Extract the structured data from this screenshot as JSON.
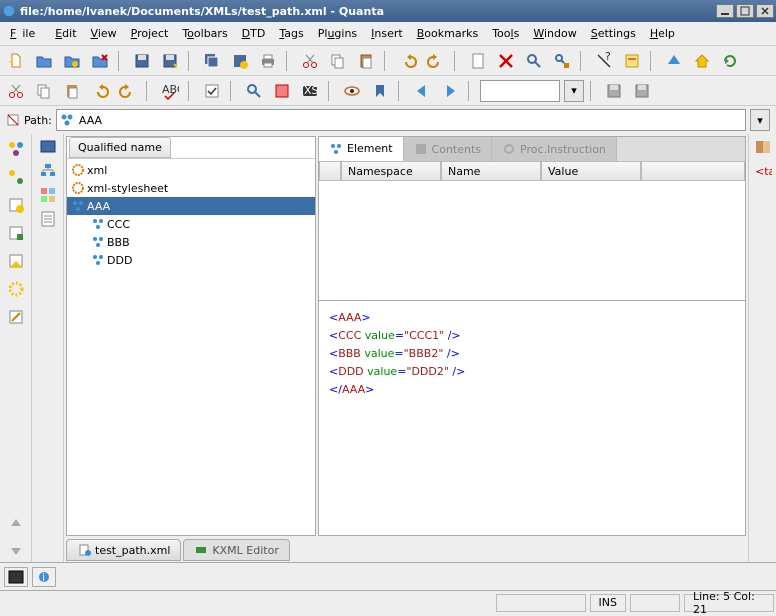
{
  "window": {
    "title": "file:/home/lvanek/Documents/XMLs/test_path.xml - Quanta"
  },
  "menu": {
    "file": "File",
    "edit": "Edit",
    "view": "View",
    "project": "Project",
    "toolbars": "Toolbars",
    "dtd": "DTD",
    "tags": "Tags",
    "plugins": "Plugins",
    "insert": "Insert",
    "bookmarks": "Bookmarks",
    "tools": "Tools",
    "window": "Window",
    "settings": "Settings",
    "help": "Help"
  },
  "pathbar": {
    "label": "Path:",
    "value": "AAA"
  },
  "tree": {
    "header": "Qualified name",
    "nodes": {
      "xml": "xml",
      "xmlss": "xml-stylesheet",
      "aaa": "AAA",
      "ccc": "CCC",
      "bbb": "BBB",
      "ddd": "DDD"
    }
  },
  "rtabs": {
    "element": "Element",
    "contents": "Contents",
    "proc": "Proc.Instruction"
  },
  "rtable": {
    "ns": "Namespace",
    "name": "Name",
    "value": "Value"
  },
  "code": {
    "l1a": "<",
    "l1b": "AAA",
    "l1c": ">",
    "l2a": "  <",
    "l2b": "CCC",
    "l2attr": " value",
    "l2eq": "=",
    "l2v": "\"CCC1\"",
    "l2e": " />",
    "l3a": "  <",
    "l3b": "BBB",
    "l3attr": " value",
    "l3eq": "=",
    "l3v": "\"BBB2\"",
    "l3e": " />",
    "l4a": "  <",
    "l4b": "DDD",
    "l4attr": " value",
    "l4eq": "=",
    "l4v": "\"DDD2\"",
    "l4e": " />",
    "l5a": "</",
    "l5b": "AAA",
    "l5c": ">"
  },
  "bottomtabs": {
    "file": "test_path.xml",
    "kxml": "KXML Editor"
  },
  "status": {
    "ins": "INS",
    "pos": "Line: 5 Col: 21"
  }
}
